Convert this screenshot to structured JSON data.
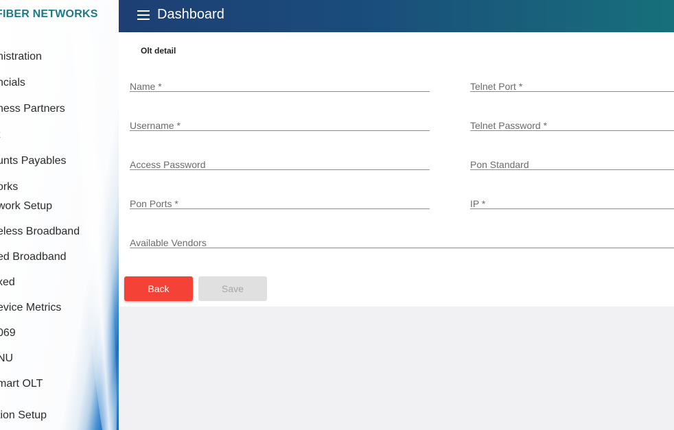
{
  "sidebar": {
    "brand": "FIBER NETWORKS",
    "items": [
      {
        "label": "nistration"
      },
      {
        "label": "ncials"
      },
      {
        "label": "ness Partners"
      },
      {
        "label": "t"
      },
      {
        "label": "unts Payables"
      },
      {
        "label": "orks"
      },
      {
        "label": "work Setup"
      },
      {
        "label": "eless Broadband"
      },
      {
        "label": "ed Broadband"
      },
      {
        "label": "xed"
      },
      {
        "label": "evice Metrics"
      },
      {
        "label": "069"
      },
      {
        "label": "NU"
      },
      {
        "label": "mart OLT"
      },
      {
        "label": "tion Setup"
      }
    ]
  },
  "header": {
    "title": "Dashboard"
  },
  "form": {
    "section_title": "Olt detail",
    "fields": {
      "name": "Name *",
      "telnet_port": "Telnet Port *",
      "username": "Username *",
      "telnet_password": "Telnet Password *",
      "access_password": "Access Password",
      "pon_standard": "Pon Standard",
      "pon_ports": "Pon Ports *",
      "ip": "IP *",
      "available_vendors": "Available Vendors"
    },
    "back_label": "Back",
    "save_label": "Save"
  },
  "colors": {
    "brand": "#1c7a86",
    "back_button": "#f44336",
    "save_button_disabled": "#e0e0e0",
    "header_start": "#1d3f74",
    "header_end": "#17707b"
  }
}
